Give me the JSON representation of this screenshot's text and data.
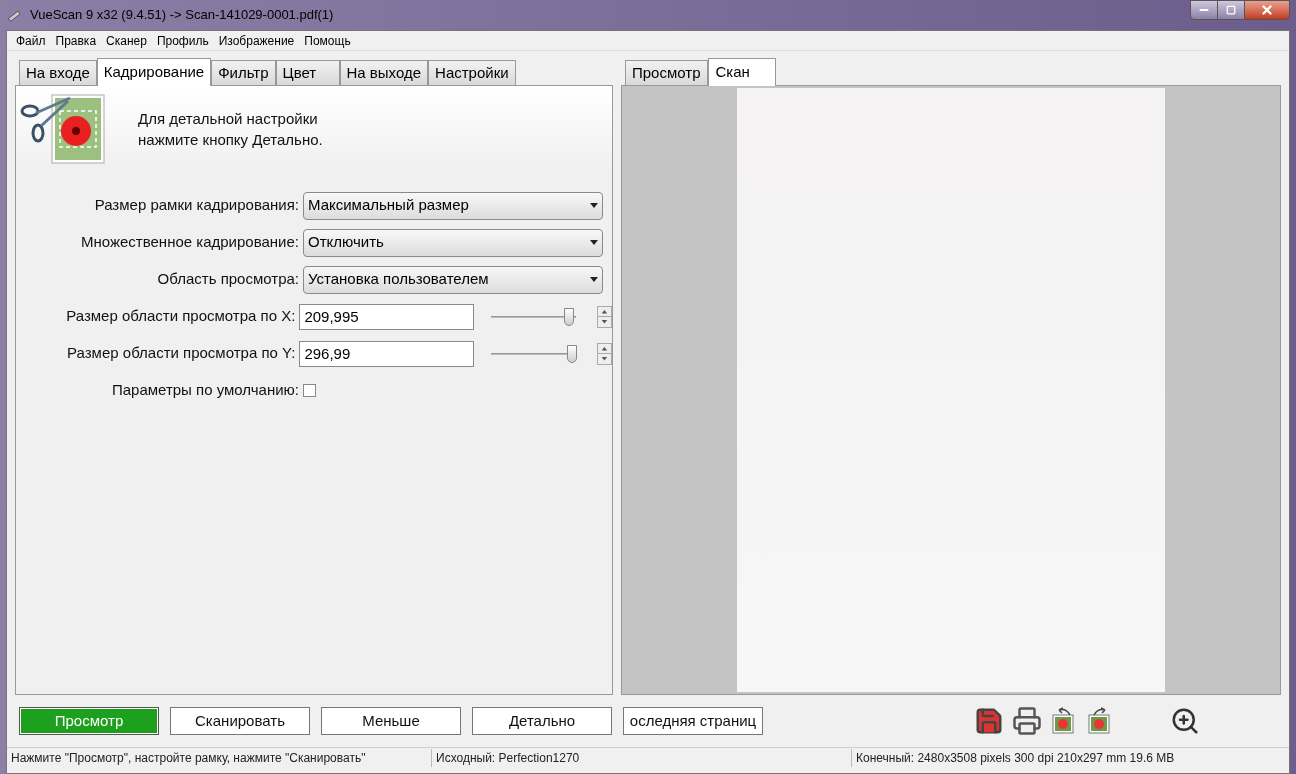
{
  "window": {
    "title": "VueScan 9 x32 (9.4.51) -> Scan-141029-0001.pdf(1)"
  },
  "menu": [
    "Файл",
    "Правка",
    "Сканер",
    "Профиль",
    "Изображение",
    "Помощь"
  ],
  "left_tabs": [
    {
      "label": "На входе",
      "selected": false
    },
    {
      "label": "Кадрирование",
      "selected": true
    },
    {
      "label": "Фильтр",
      "selected": false
    },
    {
      "label": "Цвет",
      "selected": false
    },
    {
      "label": "На выходе",
      "selected": false
    },
    {
      "label": "Настройки",
      "selected": false
    }
  ],
  "hint": [
    "Для детальной настройки",
    "нажмите кнопку Детально."
  ],
  "settings": [
    {
      "kind": "select",
      "label": "Размер рамки кадрирования:",
      "value": "Максимальный размер"
    },
    {
      "kind": "select",
      "label": "Множественное кадрирование:",
      "value": "Отключить"
    },
    {
      "kind": "select",
      "label": "Область просмотра:",
      "value": "Установка пользователем"
    },
    {
      "kind": "slider",
      "label": "Размер области просмотра по X:",
      "value": "209,995",
      "level": 0.92
    },
    {
      "kind": "slider",
      "label": "Размер области просмотра по Y:",
      "value": "296,99",
      "level": 0.95
    },
    {
      "kind": "checkbox",
      "label": "Параметры по умолчанию:",
      "checked": false
    }
  ],
  "right_tabs": [
    {
      "label": "Просмотр",
      "selected": false
    },
    {
      "label": "Скан",
      "selected": true
    }
  ],
  "buttons": [
    {
      "label": "Просмотр",
      "primary": true
    },
    {
      "label": "Сканировать",
      "primary": false
    },
    {
      "label": "Меньше",
      "primary": false
    },
    {
      "label": "Детально",
      "primary": false
    },
    {
      "label": "оследняя страниц",
      "primary": false
    }
  ],
  "status_bar": [
    "Нажмите \"Просмотр\", настройте рамку, нажмите \"Сканировать\"",
    "Исходный: Perfection1270",
    "Конечный: 2480x3508 pixels 300 dpi 210x297 mm 19.6 MB"
  ]
}
